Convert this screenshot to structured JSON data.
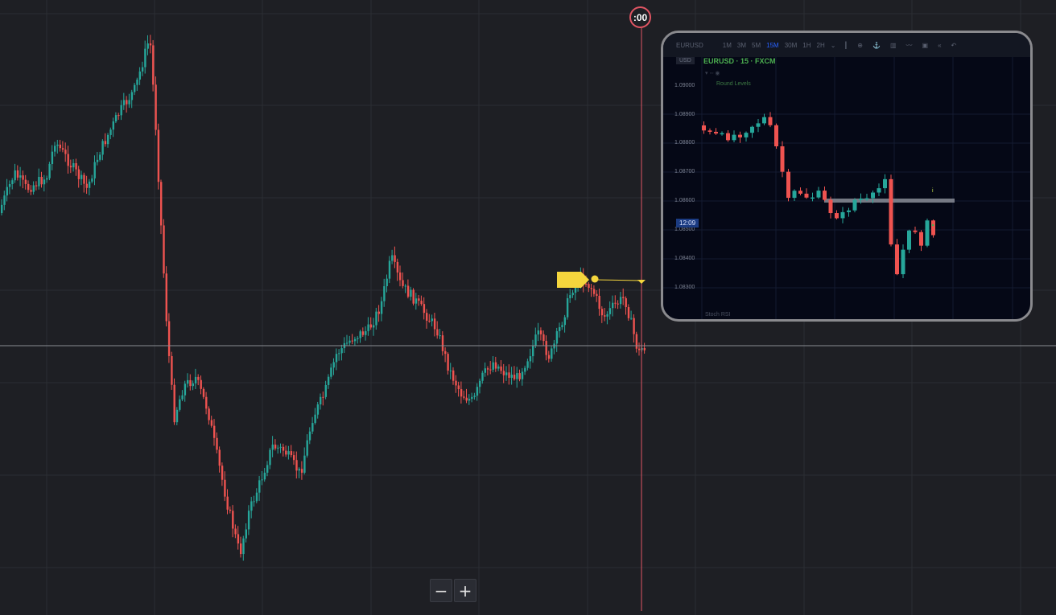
{
  "main_chart": {
    "background": "#1e1f24",
    "up_color": "#26a69a",
    "down_color": "#ef5350",
    "price_line_color": "#888a90",
    "countdown_line_color": "#e05563",
    "timer_text": ":00",
    "marker_color": "#f5d63d"
  },
  "zoom": {
    "out_label": "−",
    "in_label": "+"
  },
  "inset": {
    "toolbar": {
      "symbol": "EURUSD",
      "intervals": [
        "1M",
        "3M",
        "5M",
        "15M",
        "30M",
        "1H",
        "2H"
      ],
      "active_interval": "15M"
    },
    "title": "EURUSD · 15 · FXCM",
    "currency": "USD",
    "indicator_label": "Round Levels",
    "time_label": "12:09",
    "stoch_label": "Stoch RSI",
    "price_ticks": [
      "1.09000",
      "1.08900",
      "1.08800",
      "1.08700",
      "1.08600",
      "1.08500",
      "1.08400",
      "1.08300"
    ],
    "up_color": "#26a69a",
    "down_color": "#ef5350"
  }
}
